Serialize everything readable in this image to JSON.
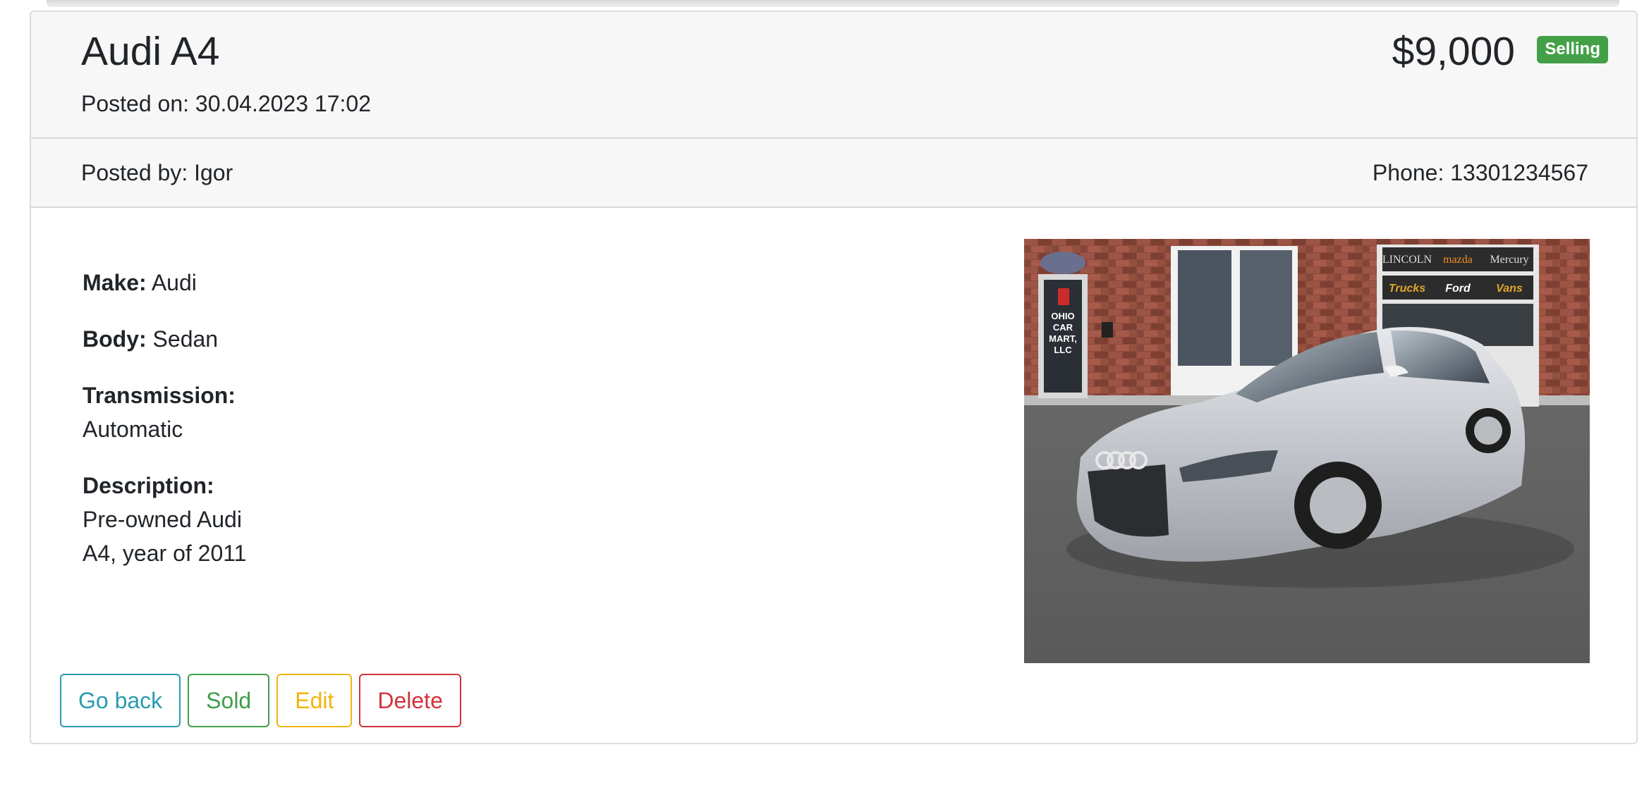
{
  "listing": {
    "title": "Audi A4",
    "posted_on": "Posted on: 30.04.2023 17:02",
    "price": "$9,000",
    "status_badge": "Selling",
    "posted_by": "Posted by: Igor",
    "phone": "Phone: 13301234567"
  },
  "specs": [
    {
      "label": "Make:",
      "value": "Audi"
    },
    {
      "label": "Body:",
      "value": "Sedan"
    },
    {
      "label": "Transmission:",
      "value": "Automatic"
    },
    {
      "label": "Description:",
      "value": "Pre-owned Audi A4, year of 2011"
    }
  ],
  "buttons": {
    "go_back": "Go back",
    "sold": "Sold",
    "edit": "Edit",
    "delete": "Delete"
  },
  "photo": {
    "door_sign": [
      "OHIO",
      "CAR",
      "MART,",
      "LLC"
    ],
    "window_brands": [
      "LINCOLN",
      "mazda",
      "Mercury"
    ],
    "window_words": [
      "Trucks",
      "Ford",
      "Vans"
    ]
  },
  "colors": {
    "badge": "#43a047",
    "info": "#2a9bb1",
    "success": "#3f9e49",
    "warning": "#f2b40f",
    "danger": "#d2333b"
  }
}
